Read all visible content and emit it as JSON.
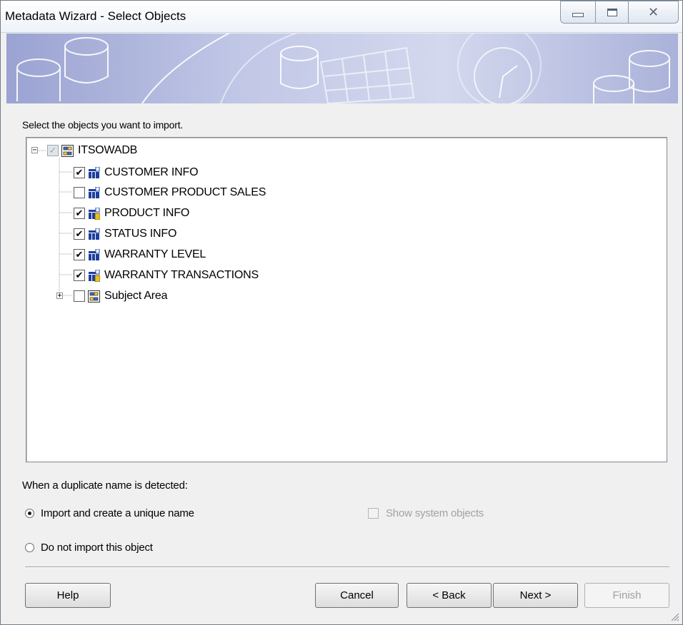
{
  "window": {
    "title": "Metadata Wizard - Select Objects"
  },
  "prompt": "Select the objects you want to import.",
  "tree": {
    "root": {
      "label": "ITSOWADB",
      "expanded": true,
      "state": "indeterminate",
      "icon": "database-icon"
    },
    "items": [
      {
        "label": "CUSTOMER INFO",
        "checked": true,
        "icon": "table-icon"
      },
      {
        "label": "CUSTOMER PRODUCT SALES",
        "checked": false,
        "icon": "table-icon"
      },
      {
        "label": "PRODUCT INFO",
        "checked": true,
        "icon": "table-key-icon"
      },
      {
        "label": "STATUS INFO",
        "checked": true,
        "icon": "table-icon"
      },
      {
        "label": "WARRANTY LEVEL",
        "checked": true,
        "icon": "table-icon"
      },
      {
        "label": "WARRANTY TRANSACTIONS",
        "checked": true,
        "icon": "table-key-icon"
      },
      {
        "label": "Subject Area",
        "checked": false,
        "icon": "subject-area-icon",
        "expandable": true
      }
    ]
  },
  "duplicate": {
    "label": "When a duplicate name is detected:",
    "options": [
      {
        "label": "Import and create a unique name",
        "selected": true
      },
      {
        "label": "Do not import this object",
        "selected": false
      }
    ]
  },
  "show_system_objects": {
    "label": "Show system objects",
    "checked": false,
    "enabled": false
  },
  "buttons": {
    "help": "Help",
    "cancel": "Cancel",
    "back": "< Back",
    "next": "Next >",
    "finish": "Finish"
  },
  "colors": {
    "banner": "#b8bfe2",
    "tree_bg": "#ffffff",
    "dialog_bg": "#f0f0f0"
  }
}
